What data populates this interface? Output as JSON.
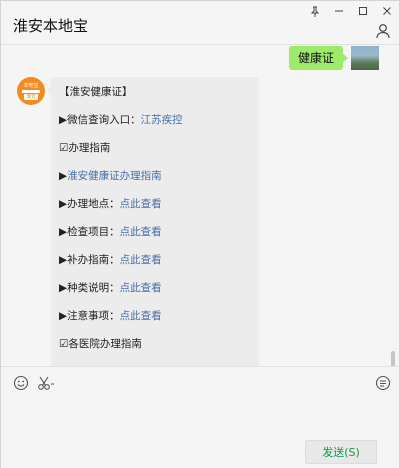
{
  "window": {
    "title": "淮安本地宝",
    "controls": [
      "pin-icon",
      "minimize-icon",
      "maximize-icon",
      "close-icon"
    ]
  },
  "chat": {
    "outgoing": {
      "text": "健康证"
    },
    "incoming": {
      "avatar_text_top": "本地宝",
      "avatar_text_bottom": "淮安",
      "lines": [
        {
          "prefix": "【淮安健康证】",
          "link": ""
        },
        {
          "prefix": "▶微信查询入口：",
          "link": "江苏疾控"
        },
        {
          "prefix": "☑办理指南",
          "link": ""
        },
        {
          "prefix": "▶",
          "link": "淮安健康证办理指南"
        },
        {
          "prefix": "▶办理地点：",
          "link": "点此查看"
        },
        {
          "prefix": "▶检查项目：",
          "link": "点此查看"
        },
        {
          "prefix": "▶补办指南：",
          "link": "点此查看"
        },
        {
          "prefix": "▶种类说明：",
          "link": "点此查看"
        },
        {
          "prefix": "▶注意事项：",
          "link": "点此查看"
        },
        {
          "prefix": "☑各医院办理指南",
          "link": ""
        }
      ]
    }
  },
  "composer": {
    "tools": [
      "emoji-icon",
      "screenshot-scissors-icon",
      "chat-history-icon"
    ],
    "send_label": "发送(S)"
  },
  "colors": {
    "outgoing_bubble": "#9eea6a",
    "incoming_bubble": "#ececec",
    "link": "#4a6ea8",
    "send_text": "#0b9a4a",
    "avatar_orange": "#f28c1e"
  }
}
